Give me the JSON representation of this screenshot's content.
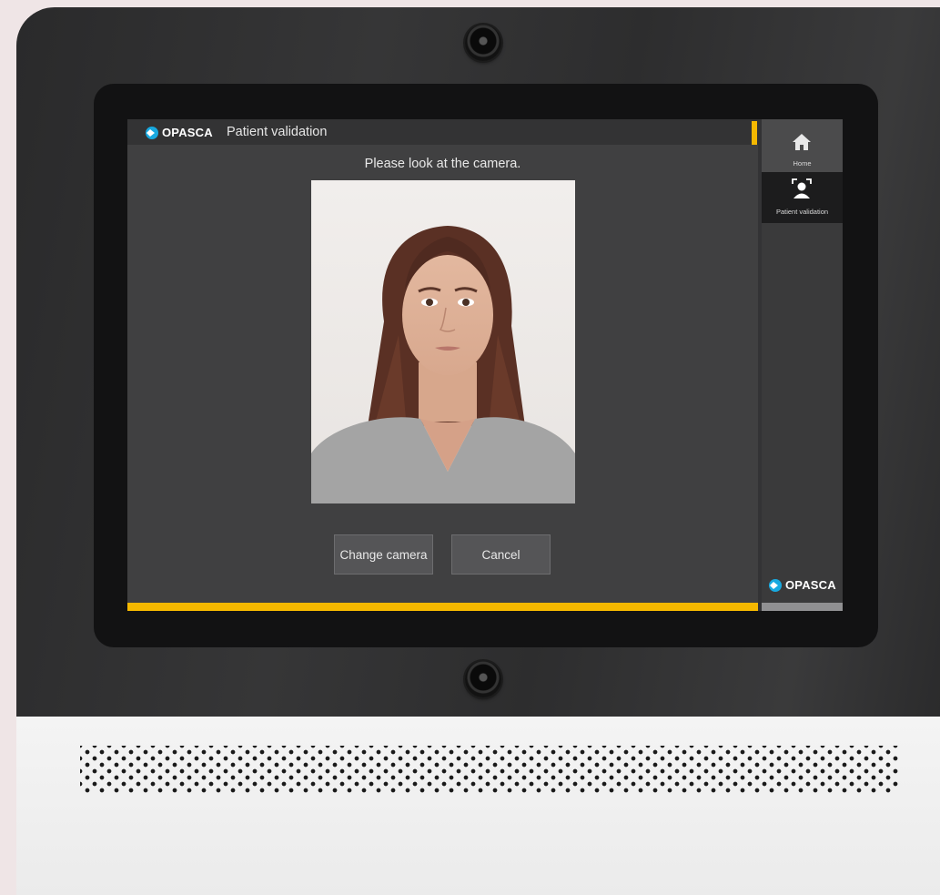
{
  "app": {
    "brand": "OPASCA",
    "title": "Patient validation"
  },
  "main": {
    "prompt": "Please look at the camera.",
    "buttons": {
      "change_camera": "Change camera",
      "cancel": "Cancel"
    }
  },
  "sidebar": {
    "items": [
      {
        "label": "Home",
        "icon": "home-icon",
        "selected": false
      },
      {
        "label": "Patient validation",
        "icon": "face-scan-icon",
        "selected": true
      }
    ],
    "footer_brand": "OPASCA"
  },
  "colors": {
    "accent": "#f5b800",
    "brand": "#18a9e0",
    "panel": "#404041"
  }
}
